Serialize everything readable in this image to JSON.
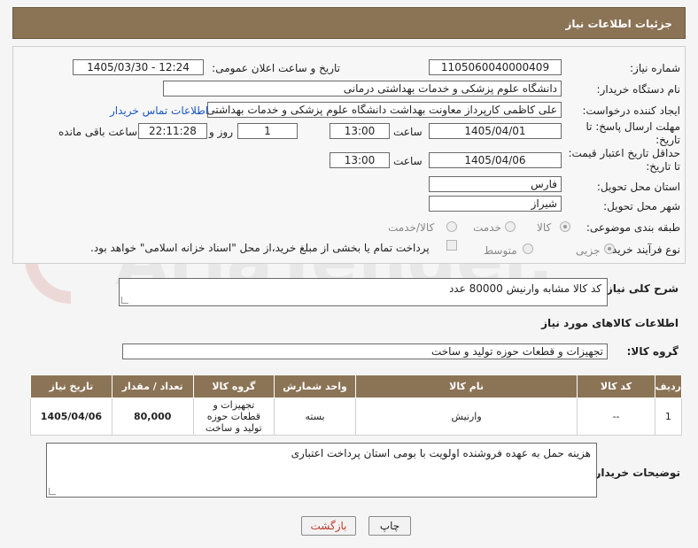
{
  "header": {
    "title": "جزئیات اطلاعات نیاز"
  },
  "form": {
    "need_number": {
      "label": "شماره نیاز:",
      "value": "1105060040000409"
    },
    "announce_datetime": {
      "label": "تاریخ و ساعت اعلان عمومی:",
      "value": "1405/03/30 - 12:24"
    },
    "buyer_org": {
      "label": "نام دستگاه خریدار:",
      "value": "دانشگاه علوم پزشکی و خدمات بهداشتی درمانی"
    },
    "requester": {
      "label": "ایجاد کننده درخواست:",
      "value": "علی کاظمی کارپرداز معاونت بهداشت دانشگاه علوم پزشکی و خدمات بهداشتی",
      "contact_link": "اطلاعات تماس خریدار"
    },
    "reply_deadline": {
      "label1": "مهلت ارسال پاسخ: تا",
      "label2": "تاریخ:",
      "date": "1405/04/01",
      "time_label": "ساعت",
      "time": "13:00",
      "days": "1",
      "days_label": "روز و",
      "remaining": "22:11:28",
      "remaining_label": "ساعت باقی مانده"
    },
    "price_validity": {
      "label1": "حداقل تاریخ اعتبار قیمت:",
      "label2": "تا تاریخ:",
      "date": "1405/04/06",
      "time_label": "ساعت",
      "time": "13:00"
    },
    "province": {
      "label": "استان محل تحویل:",
      "value": "فارس"
    },
    "city": {
      "label": "شهر محل تحویل:",
      "value": "شیراز"
    },
    "category": {
      "label": "طبقه بندی موضوعی:",
      "options": [
        "کالا",
        "خدمت",
        "کالا/خدمت"
      ],
      "selected": "کالا"
    },
    "purchase_type": {
      "label": "نوع فرآیند خرید :",
      "options": [
        "جزیی",
        "متوسط"
      ],
      "selected": "جزیی",
      "payment_note": "پرداخت تمام یا بخشی از مبلغ خرید،از محل \"اسناد خزانه اسلامی\" خواهد بود."
    }
  },
  "description": {
    "label": "شرح کلی نیاز:",
    "value": "کد کالا مشابه وارنیش 80000 عدد"
  },
  "goods_info": {
    "title": "اطلاعات کالاهای مورد نیاز"
  },
  "goods_group": {
    "label": "گروه کالا:",
    "value": "تجهیزات و قطعات حوزه تولید و ساخت"
  },
  "table": {
    "headers": [
      "ردیف",
      "کد کالا",
      "نام کالا",
      "واحد شمارش",
      "گروه کالا",
      "تعداد / مقدار",
      "تاریخ نیاز"
    ],
    "rows": [
      [
        "1",
        "--",
        "وارنیش",
        "بسته",
        "تجهیزات و قطعات حوزه تولید و ساخت",
        "80,000",
        "1405/04/06"
      ]
    ]
  },
  "buyer_notes": {
    "label": "توضیحات خریدار:",
    "value": "هزینه حمل به عهده فروشنده اولویت با بومی استان پرداخت اعتباری"
  },
  "buttons": {
    "print": "چاپ",
    "back": "بازگشت"
  },
  "watermark": {
    "text": "AriaTender.neT"
  },
  "colors": {
    "header_bg": "#8b7355",
    "link": "#1a56c4",
    "back_text": "#c0392b"
  }
}
